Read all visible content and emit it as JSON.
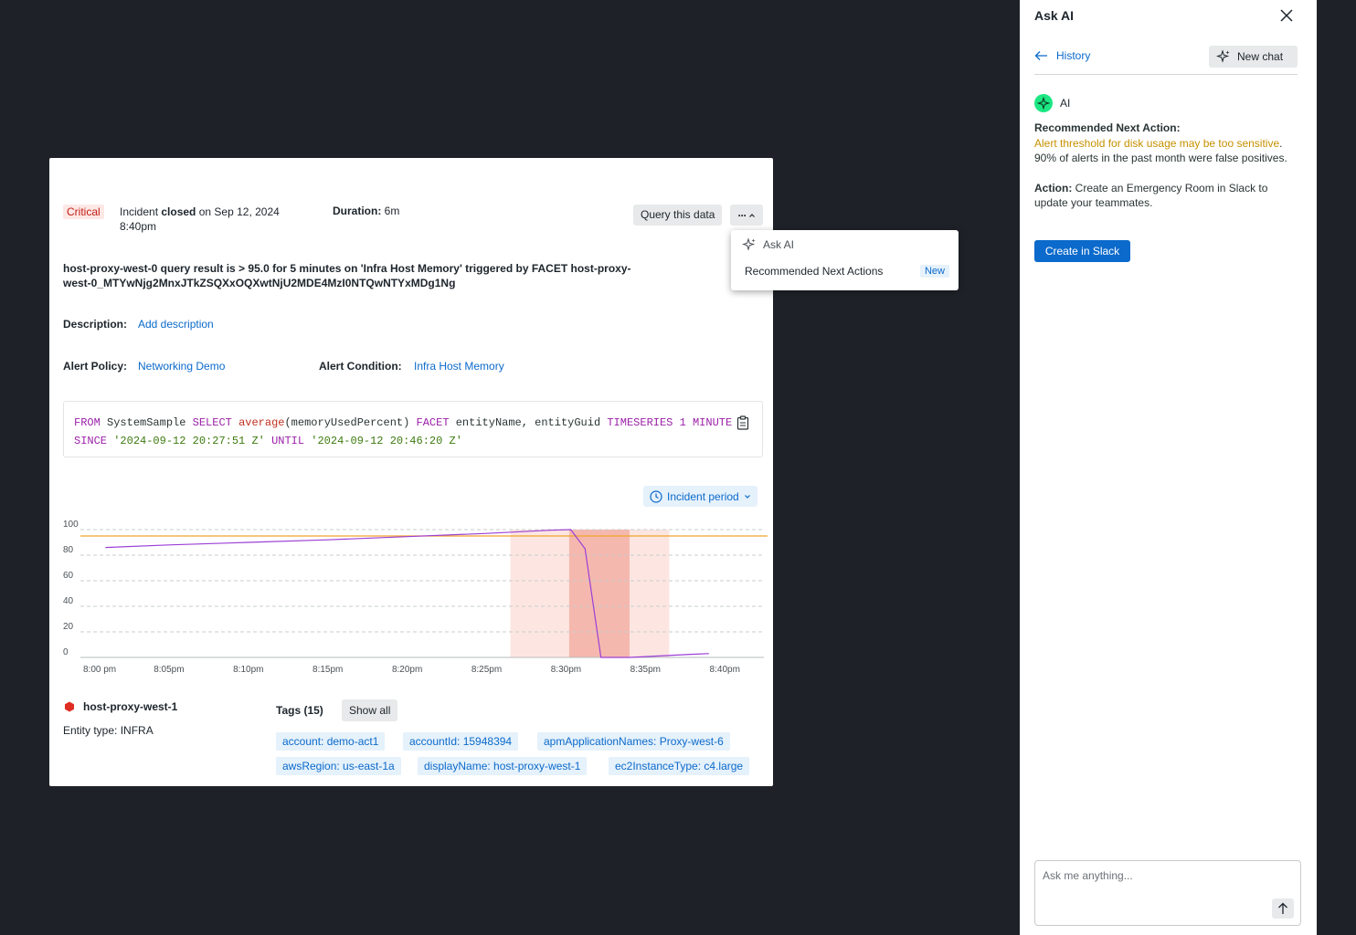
{
  "incident": {
    "severity": "Critical",
    "status_prefix": "Incident ",
    "status_word": "closed",
    "status_suffix": " on Sep 12, 2024 8:40pm",
    "duration_label": "Duration:",
    "duration_value": " 6m",
    "query_button": "Query this data",
    "more_button": "···",
    "title": "host-proxy-west-0 query result is > 95.0 for 5 minutes on 'Infra Host Memory' triggered by FACET host-proxy-west-0_MTYwNjg2MnxJTkZSQXxOQXwtNjU2MDE4MzI0NTQwNTYxMDg1Ng",
    "description_label": "Description:",
    "description_link": "Add description",
    "policy_label": "Alert Policy:",
    "policy_value": "Networking Demo",
    "condition_label": "Alert Condition:",
    "condition_value": "Infra Host Memory",
    "period_button": "Incident period"
  },
  "query": {
    "tokens_line1": [
      {
        "t": "FROM",
        "c": "kw"
      },
      {
        "t": " SystemSample ",
        "c": "plain"
      },
      {
        "t": "SELECT",
        "c": "kw"
      },
      {
        "t": " ",
        "c": "plain"
      },
      {
        "t": "average",
        "c": "fn"
      },
      {
        "t": "(memoryUsedPercent) ",
        "c": "plain"
      },
      {
        "t": "FACET",
        "c": "kw"
      },
      {
        "t": " entityName, entityGuid ",
        "c": "plain"
      },
      {
        "t": "TIMESERIES",
        "c": "kw"
      },
      {
        "t": " ",
        "c": "plain"
      },
      {
        "t": "1",
        "c": "num"
      },
      {
        "t": " ",
        "c": "plain"
      },
      {
        "t": "MINUTE",
        "c": "kw"
      }
    ],
    "tokens_line2": [
      {
        "t": "SINCE",
        "c": "kw"
      },
      {
        "t": " ",
        "c": "plain"
      },
      {
        "t": "'2024-09-12 20:27:51 Z'",
        "c": "str"
      },
      {
        "t": " ",
        "c": "plain"
      },
      {
        "t": "UNTIL",
        "c": "kw"
      },
      {
        "t": " ",
        "c": "plain"
      },
      {
        "t": "'2024-09-12 20:46:20 Z'",
        "c": "str"
      }
    ]
  },
  "chart_data": {
    "type": "line",
    "x_ticks": [
      "8:00 pm",
      "8:05pm",
      "8:10pm",
      "8:15pm",
      "8:20pm",
      "8:25pm",
      "8:30pm",
      "8:35pm",
      "8:40pm"
    ],
    "y_ticks": [
      0,
      20,
      40,
      60,
      80,
      100
    ],
    "ylim": [
      0,
      100
    ],
    "xlim_minutes_after_8pm": [
      0,
      42
    ],
    "threshold": 95,
    "incident_window_minutes": [
      26.5,
      36.5
    ],
    "critical_window_minutes": [
      30.2,
      34
    ],
    "series": [
      {
        "color": "#9b3fd6",
        "x_minutes": [
          1,
          5,
          10,
          15,
          20,
          25,
          29,
          30.3,
          31.2,
          32.2,
          34,
          38,
          39
        ],
        "values": [
          86,
          88,
          90,
          92,
          94.5,
          97,
          99.5,
          100,
          85,
          0,
          0,
          2.5,
          3
        ]
      }
    ],
    "threshold_color": "#f0a52a",
    "line_color": "#9b3fd6"
  },
  "entity": {
    "name": "host-proxy-west-1",
    "type": "Entity type: INFRA",
    "tags_label": "Tags (15)",
    "show_all": "Show all",
    "tags": [
      "account: demo-act1",
      "accountId: 15948394",
      "apmApplicationNames: Proxy-west-6",
      "awsRegion: us-east-1a",
      "displayName: host-proxy-west-1",
      "ec2InstanceType: c4.large"
    ]
  },
  "menu": {
    "ask_ai": "Ask AI",
    "recommended": "Recommended Next Actions",
    "new_badge": "New"
  },
  "panel": {
    "title": "Ask AI",
    "history": "History",
    "new_chat": "New chat",
    "ai_label": "AI",
    "rec_heading": "Recommended Next Action:",
    "warning_text": "Alert threshold for disk usage may be too sensitive",
    "rec_rest": ". 90% of alerts in the past month were false positives.",
    "action_label": "Action:",
    "action_text": " Create an Emergency Room in Slack to update your teammates.",
    "slack_button": "Create in Slack",
    "input_placeholder": "Ask me anything..."
  },
  "colors": {
    "accent": "#0b6acb",
    "critical": "#c51d14",
    "warning_text": "#c69000",
    "ai_green": "#1ce783"
  }
}
